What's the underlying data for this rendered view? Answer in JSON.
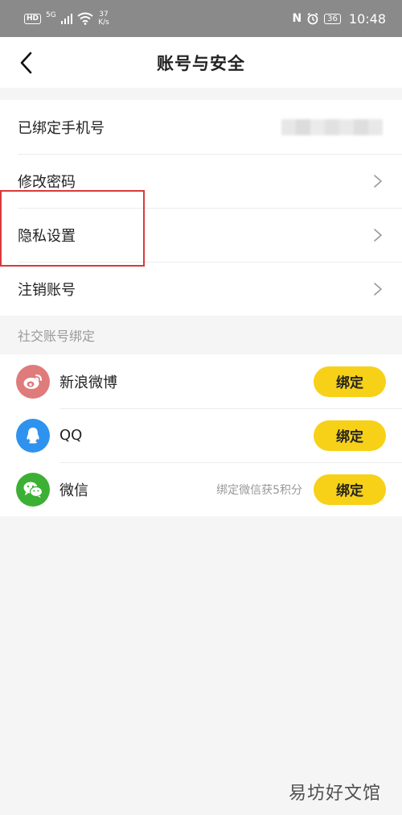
{
  "status_bar": {
    "hd": "HD",
    "network": "5G",
    "speed_value": "37",
    "speed_unit": "K/s",
    "nfc": "N",
    "battery": "36",
    "time": "10:48"
  },
  "nav": {
    "title": "账号与安全"
  },
  "account_items": [
    {
      "label": "已绑定手机号"
    },
    {
      "label": "修改密码"
    },
    {
      "label": "隐私设置"
    },
    {
      "label": "注销账号"
    }
  ],
  "social_section": {
    "header": "社交账号绑定",
    "items": [
      {
        "name": "新浪微博",
        "button": "绑定",
        "icon": "weibo-icon",
        "color": "#df7b7b"
      },
      {
        "name": "QQ",
        "button": "绑定",
        "icon": "qq-icon",
        "color": "#2e93ee"
      },
      {
        "name": "微信",
        "bonus": "绑定微信获5积分",
        "button": "绑定",
        "icon": "wechat-icon",
        "color": "#3cb034"
      }
    ]
  },
  "colors": {
    "accent": "#f7d117",
    "highlight": "#d9393a",
    "status_bar": "#8a8a8a"
  },
  "watermark": "易坊好文馆"
}
